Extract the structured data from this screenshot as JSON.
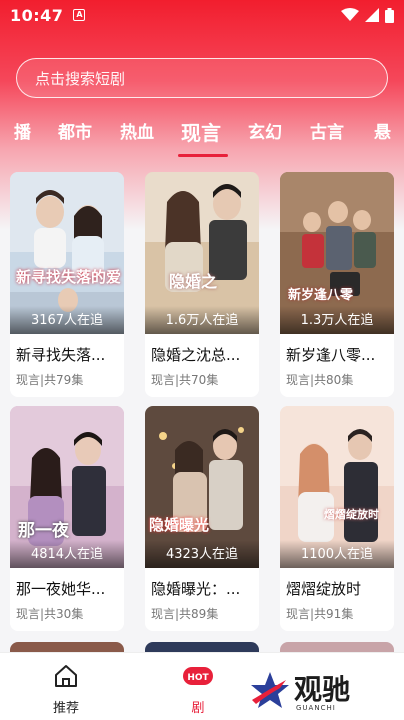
{
  "status_bar": {
    "time": "10:47",
    "a_icon": "A"
  },
  "search": {
    "placeholder": "点击搜索短剧"
  },
  "tabs": [
    {
      "label": "播"
    },
    {
      "label": "都市"
    },
    {
      "label": "热血"
    },
    {
      "label": "现言",
      "active": true
    },
    {
      "label": "玄幻"
    },
    {
      "label": "古言"
    },
    {
      "label": "悬"
    }
  ],
  "cards": [
    {
      "title": "新寻找失落...",
      "meta": "现言|共79集",
      "count": "3167人在追",
      "poster_text": "新寻找失落的爱"
    },
    {
      "title": "隐婚之沈总...",
      "meta": "现言|共70集",
      "count": "1.6万人在追",
      "poster_text": "隐婚之"
    },
    {
      "title": "新岁逢八零...",
      "meta": "现言|共80集",
      "count": "1.3万人在追",
      "poster_text": "新岁逢八零"
    },
    {
      "title": "那一夜她华...",
      "meta": "现言|共30集",
      "count": "4814人在追",
      "poster_text": "那一夜"
    },
    {
      "title": "隐婚曝光：...",
      "meta": "现言|共89集",
      "count": "4323人在追",
      "poster_text": "隐婚曝光"
    },
    {
      "title": "熠熠绽放时",
      "meta": "现言|共91集",
      "count": "1100人在追",
      "poster_text": "熠熠绽放时"
    }
  ],
  "bottom_nav": [
    {
      "label": "推荐",
      "icon": "home-icon"
    },
    {
      "label": "剧",
      "icon": "hot-icon"
    }
  ],
  "watermark": {
    "text": "观驰",
    "sub": "GUANCHI"
  },
  "colors": {
    "accent": "#e8203a",
    "header_top": "#f21e2e"
  }
}
